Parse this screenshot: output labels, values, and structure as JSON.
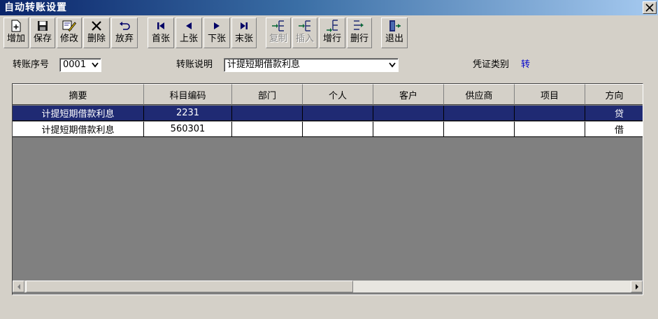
{
  "window": {
    "title": "自动转账设置",
    "close_label": "关闭"
  },
  "toolbar": {
    "add": "增加",
    "save": "保存",
    "edit": "修改",
    "delete": "删除",
    "discard": "放弃",
    "first": "首张",
    "prev": "上张",
    "next": "下张",
    "last": "末张",
    "copy": "复制",
    "insert": "插入",
    "add_row": "增行",
    "delete_row": "删行",
    "exit": "退出"
  },
  "form": {
    "seq_label": "转账序号",
    "seq_value": "0001",
    "desc_label": "转账说明",
    "desc_value": "计提短期借款利息",
    "voucher_type_label": "凭证类别",
    "voucher_type_value": "转"
  },
  "table": {
    "columns": [
      "摘要",
      "科目编码",
      "部门",
      "个人",
      "客户",
      "供应商",
      "项目",
      "方向"
    ],
    "rows": [
      {
        "summary": "计提短期借款利息",
        "account": "2231",
        "dept": "",
        "person": "",
        "customer": "",
        "supplier": "",
        "project": "",
        "direction": "贷",
        "selected": true
      },
      {
        "summary": "计提短期借款利息",
        "account": "560301",
        "dept": "",
        "person": "",
        "customer": "",
        "supplier": "",
        "project": "",
        "direction": "借",
        "selected": false
      }
    ]
  },
  "colors": {
    "selection": "#1f2a73",
    "voucher_type": "#0000cc",
    "grid_bg": "#808080"
  }
}
